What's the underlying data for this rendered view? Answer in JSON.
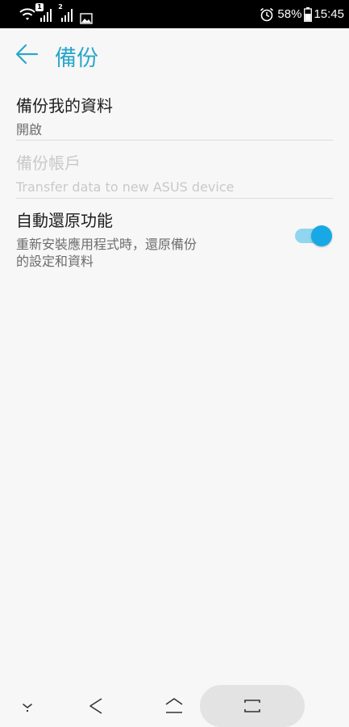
{
  "status_bar": {
    "sim1_number": "1",
    "sim2_number": "2",
    "battery": "58%",
    "time": "15:45"
  },
  "header": {
    "title": "備份"
  },
  "settings": [
    {
      "title": "備份我的資料",
      "subtitle": "開啟"
    },
    {
      "title": "備份帳戶",
      "subtitle": "Transfer data to new ASUS device"
    },
    {
      "title": "自動還原功能",
      "subtitle_line1": "重新安裝應用程式時，還原備份",
      "subtitle_line2": "的設定和資料",
      "toggle_on": true
    }
  ],
  "colors": {
    "accent": "#2aa7c9",
    "toggle_thumb": "#18a9e5",
    "toggle_track": "#8fd6ee"
  }
}
